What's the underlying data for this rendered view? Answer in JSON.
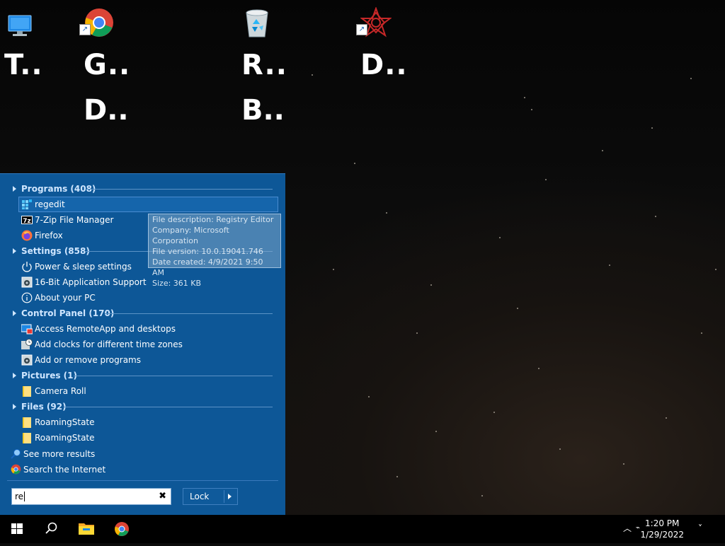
{
  "desktop": {
    "icons": [
      {
        "label": "T..",
        "icon": "this-pc-icon"
      },
      {
        "label": "G..",
        "label2": "D..",
        "icon": "chrome-icon"
      },
      {
        "label": "R..",
        "label2": "B..",
        "icon": "recycle-bin-icon"
      },
      {
        "label": "D..",
        "icon": "app-star-icon"
      }
    ]
  },
  "start_menu": {
    "categories": {
      "programs": "Programs (408)",
      "settings": "Settings (858)",
      "control_panel": "Control Panel (170)",
      "pictures": "Pictures (1)",
      "files": "Files (92)"
    },
    "programs": [
      "regedit",
      "7-Zip File Manager",
      "Firefox"
    ],
    "settings": [
      "Power & sleep settings",
      "16-Bit Application Support",
      "About your PC"
    ],
    "control_panel": [
      "Access RemoteApp and desktops",
      "Add clocks for different time zones",
      "Add or remove programs"
    ],
    "pictures": [
      "Camera Roll"
    ],
    "files": [
      "RoamingState",
      "RoamingState"
    ],
    "see_more": "See more results",
    "search_internet": "Search the Internet",
    "search_value": "re",
    "lock_label": "Lock",
    "tooltip": {
      "description": "File description: Registry Editor",
      "company": "Company: Microsoft Corporation",
      "version": "File version: 10.0.19041.746",
      "created": "Date created: 4/9/2021 9:50 AM",
      "size": "Size: 361 KB"
    }
  },
  "taskbar": {
    "time": "1:20 PM",
    "date": "1/29/2022"
  },
  "colors": {
    "menu_bg": "#0d5797",
    "category_text": "#cfe6ff",
    "taskbar_bg": "#000000"
  }
}
